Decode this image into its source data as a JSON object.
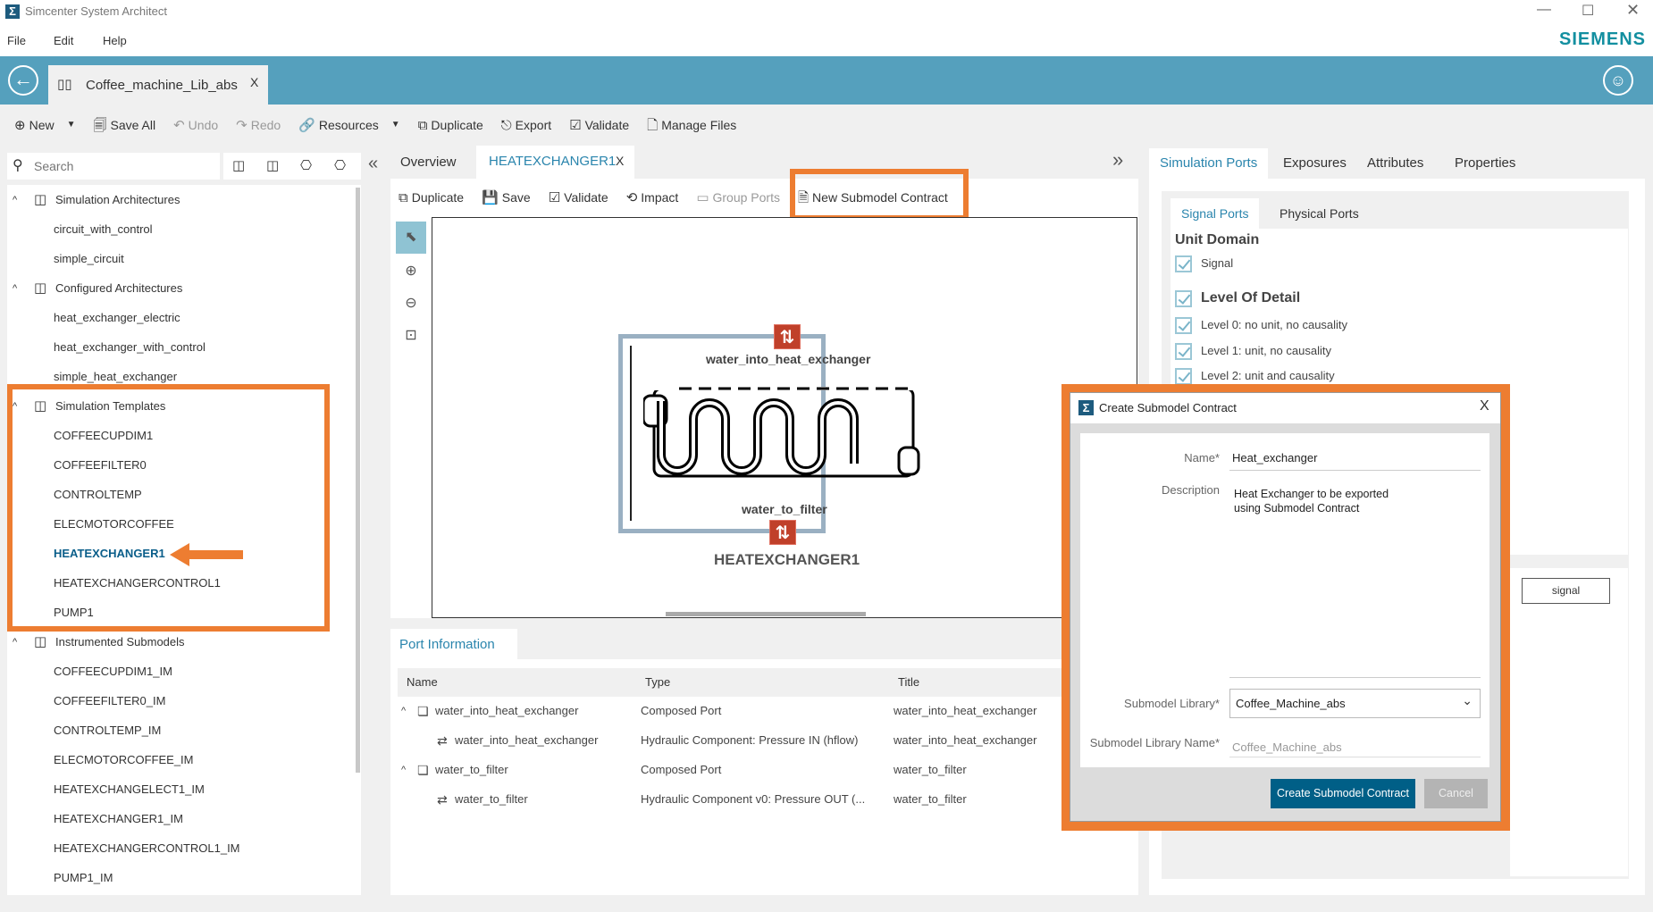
{
  "window": {
    "title": "Simcenter System Architect",
    "brand": "SIEMENS",
    "controls": [
      "minimize",
      "maximize",
      "close"
    ]
  },
  "menu": [
    "File",
    "Edit",
    "Help"
  ],
  "project_tab": {
    "label": "Coffee_machine_Lib_abs",
    "close": "X"
  },
  "toolbar": [
    {
      "label": "New",
      "icon": "plus-circle-icon",
      "enabled": true
    },
    {
      "label": "Save All",
      "icon": "save-all-icon",
      "enabled": true
    },
    {
      "label": "Undo",
      "icon": "undo-icon",
      "enabled": false
    },
    {
      "label": "Redo",
      "icon": "redo-icon",
      "enabled": false
    },
    {
      "label": "Resources",
      "icon": "link-icon",
      "enabled": true
    },
    {
      "label": "Duplicate",
      "icon": "duplicate-icon",
      "enabled": true
    },
    {
      "label": "Export",
      "icon": "export-icon",
      "enabled": true
    },
    {
      "label": "Validate",
      "icon": "validate-icon",
      "enabled": true
    },
    {
      "label": "Manage Files",
      "icon": "file-icon",
      "enabled": true
    }
  ],
  "search": {
    "placeholder": "Search"
  },
  "tree": [
    {
      "group": "Simulation Architectures",
      "items": [
        "circuit_with_control",
        "simple_circuit"
      ]
    },
    {
      "group": "Configured Architectures",
      "items": [
        "heat_exchanger_electric",
        "heat_exchanger_with_control",
        "simple_heat_exchanger"
      ]
    },
    {
      "group": "Simulation Templates",
      "items": [
        "COFFEECUPDIM1",
        "COFFEEFILTER0",
        "CONTROLTEMP",
        "ELECMOTORCOFFEE",
        "HEATEXCHANGER1",
        "HEATEXCHANGERCONTROL1",
        "PUMP1"
      ],
      "selected": "HEATEXCHANGER1"
    },
    {
      "group": "Instrumented Submodels",
      "items": [
        "COFFEECUPDIM1_IM",
        "COFFEEFILTER0_IM",
        "CONTROLTEMP_IM",
        "ELECMOTORCOFFEE_IM",
        "HEATEXCHANGELECT1_IM",
        "HEATEXCHANGER1_IM",
        "HEATEXCHANGERCONTROL1_IM",
        "PUMP1_IM"
      ]
    }
  ],
  "editor_tabs": [
    {
      "label": "Overview"
    },
    {
      "label": "HEATEXCHANGER1",
      "active": true,
      "close": "X"
    }
  ],
  "editor_toolbar": [
    {
      "label": "Duplicate",
      "enabled": true
    },
    {
      "label": "Save",
      "enabled": true
    },
    {
      "label": "Validate",
      "enabled": true
    },
    {
      "label": "Impact",
      "enabled": true
    },
    {
      "label": "Group Ports",
      "enabled": false
    },
    {
      "label": "New Submodel Contract",
      "enabled": true
    }
  ],
  "diagram": {
    "top_port": "water_into_heat_exchanger",
    "bottom_port": "water_to_filter",
    "component": "HEATEXCHANGER1"
  },
  "port_info": {
    "tab": "Port Information",
    "columns": [
      "Name",
      "Type",
      "Title"
    ],
    "rows": [
      {
        "name": "water_into_heat_exchanger",
        "type": "Composed Port",
        "title": "water_into_heat_exchanger",
        "level": 0
      },
      {
        "name": "water_into_heat_exchanger",
        "type": "Hydraulic Component: Pressure IN (hflow)",
        "title": "water_into_heat_exchanger",
        "level": 1
      },
      {
        "name": "water_to_filter",
        "type": "Composed Port",
        "title": "water_to_filter",
        "level": 0
      },
      {
        "name": "water_to_filter",
        "type": "Hydraulic Component v0: Pressure OUT (...",
        "title": "water_to_filter",
        "level": 1
      }
    ]
  },
  "right_tabs": [
    "Simulation Ports",
    "Exposures",
    "Attributes",
    "Properties"
  ],
  "right_subtabs": [
    "Signal Ports",
    "Physical Ports"
  ],
  "unit_domain": {
    "heading": "Unit Domain",
    "items": [
      {
        "label": "Signal",
        "checked": true
      }
    ]
  },
  "level_of_detail": {
    "heading": "Level Of Detail",
    "checked": true,
    "items": [
      {
        "label": "Level 0: no unit, no causality",
        "checked": true
      },
      {
        "label": "Level 1: unit, no causality",
        "checked": true
      },
      {
        "label": "Level 2: unit and causality",
        "checked": true
      }
    ]
  },
  "signal_button": "signal",
  "dialog": {
    "title": "Create Submodel Contract",
    "close": "X",
    "name_label": "Name*",
    "name_value": "Heat_exchanger",
    "description_label": "Description",
    "description_value": "Heat Exchanger to be exported using Submodel Contract",
    "library_label": "Submodel Library*",
    "library_value": "Coffee_Machine_abs",
    "library_name_label": "Submodel Library Name*",
    "library_name_value": "Coffee_Machine_abs",
    "create_button": "Create Submodel Contract",
    "cancel_button": "Cancel"
  },
  "colors": {
    "accent": "#55a0bd",
    "highlight": "#ed7d31",
    "primary_button": "#005f87",
    "port": "#c0402a"
  }
}
